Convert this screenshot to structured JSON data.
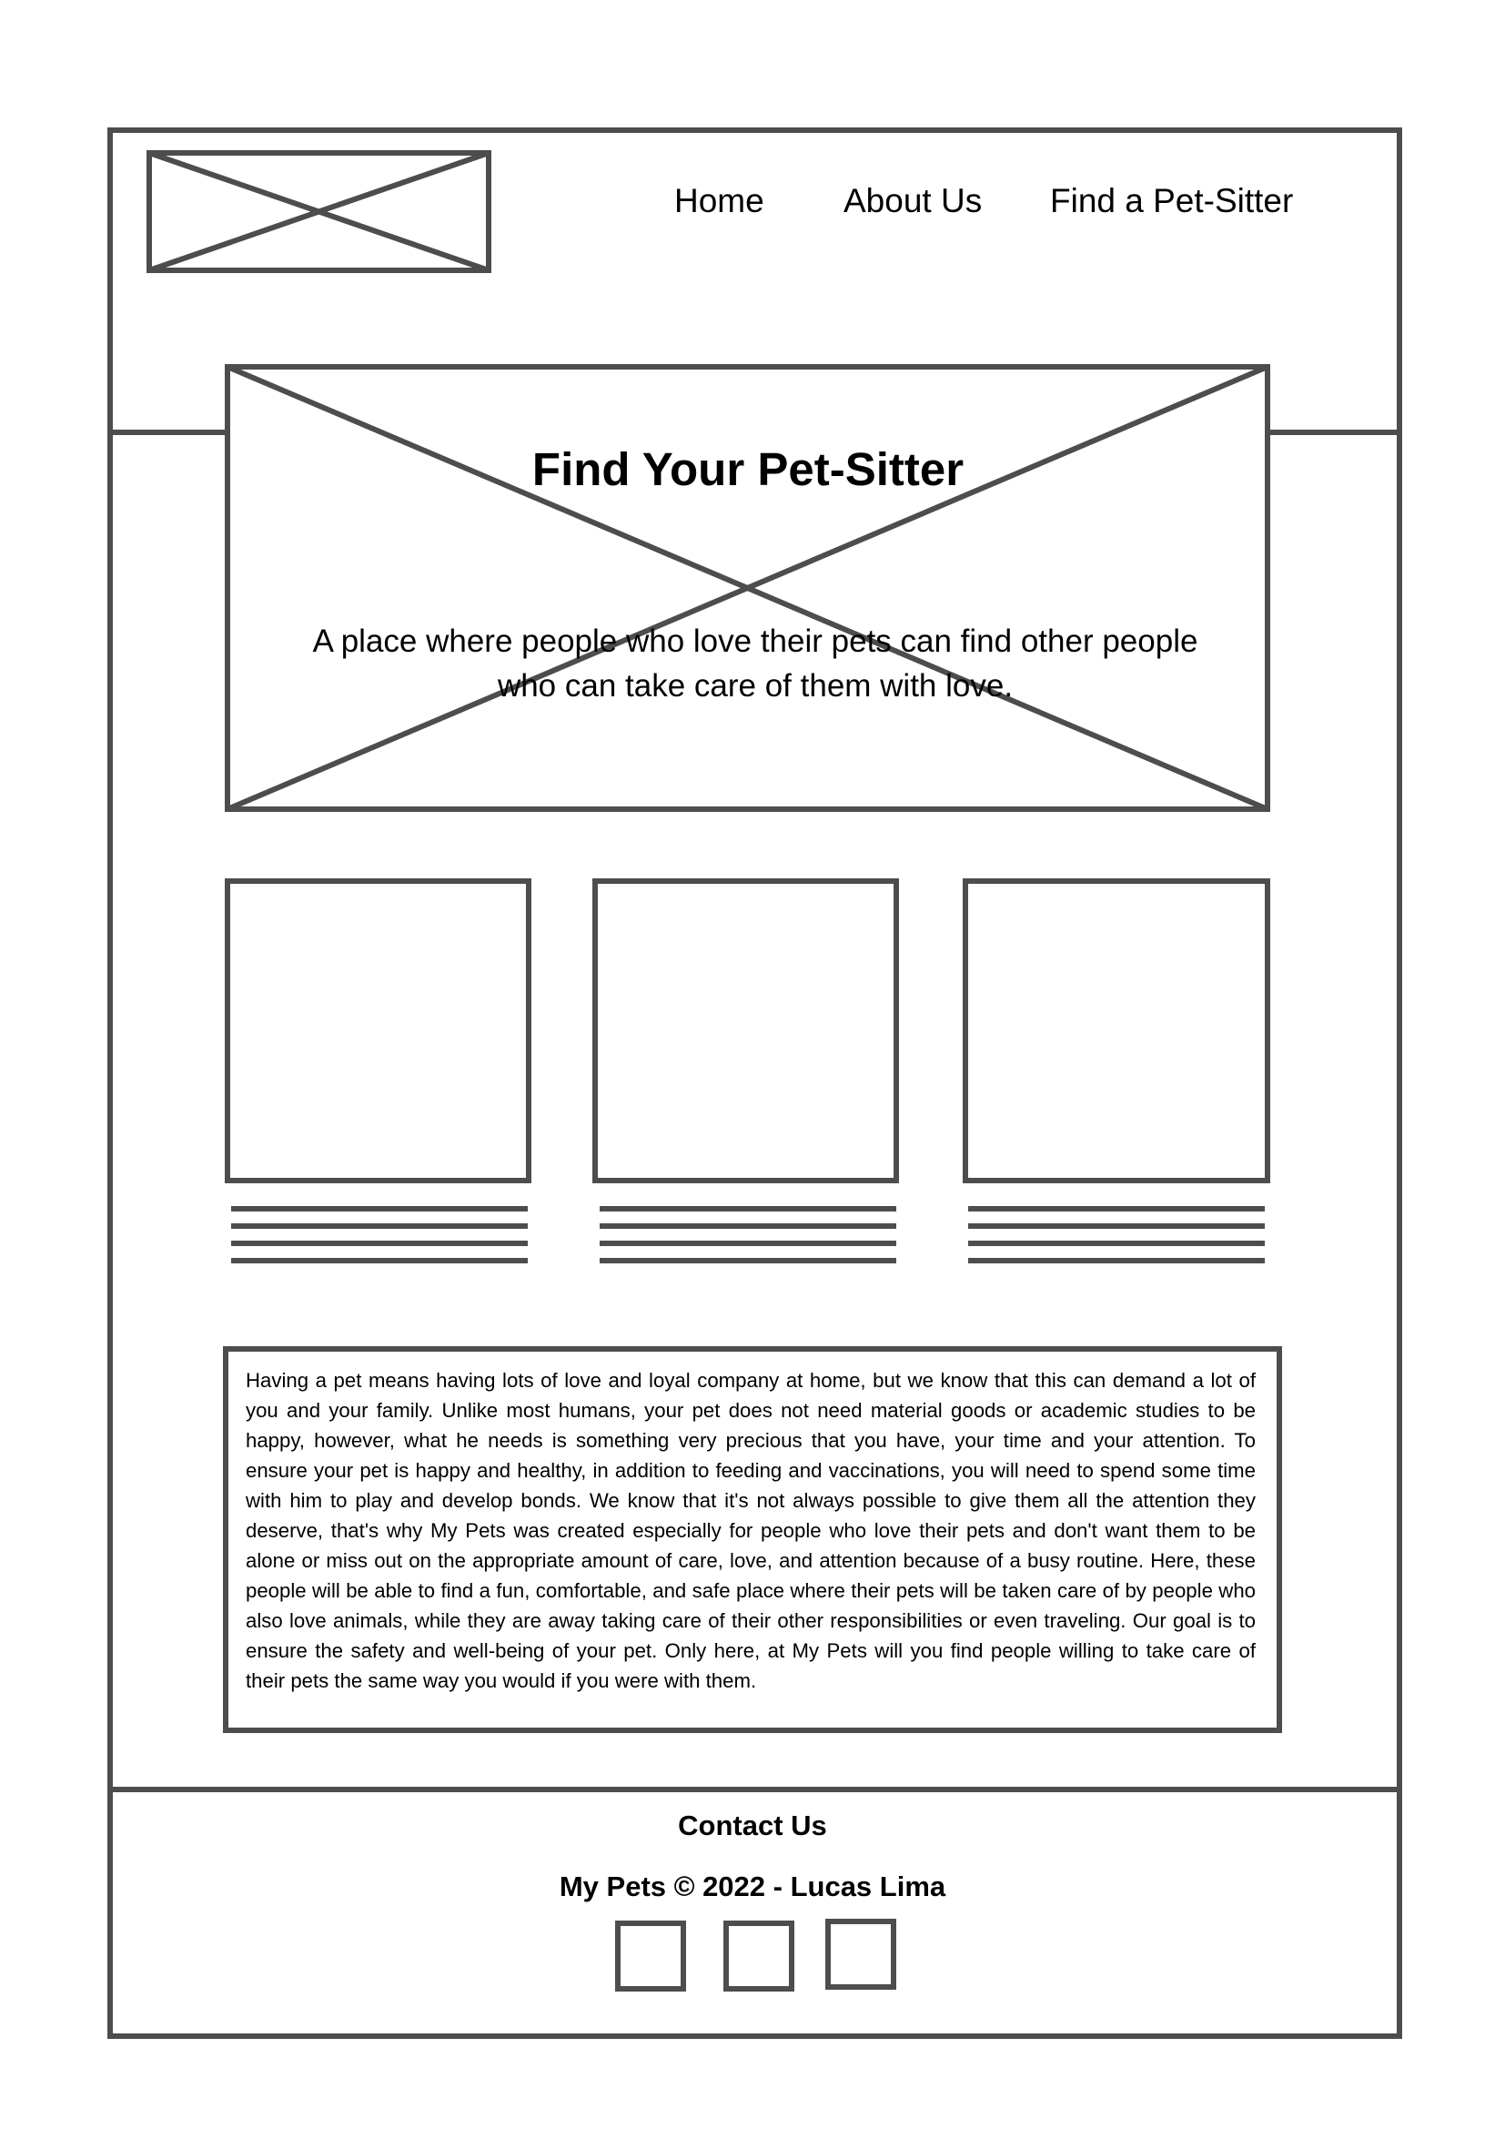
{
  "nav": {
    "items": [
      "Home",
      "About Us",
      "Find a Pet-Sitter"
    ]
  },
  "hero": {
    "title": "Find Your Pet-Sitter",
    "subtitle": "A place where people who love their pets can find other people who can take care of them with love."
  },
  "about": {
    "text": "Having a pet means having lots of love and loyal company at home, but we know that this can demand a lot of you and your family. Unlike most humans, your pet does not need material goods or academic studies to be happy, however, what he needs is something very precious that you have, your time and your attention. To ensure your pet is happy and healthy, in addition to feeding and vaccinations, you will need to spend some time with him to play and develop bonds. We know that it's not always possible to give them all the attention they deserve, that's why My Pets was created especially for people who love their pets and don't want them to be alone or miss out on the appropriate amount of care, love, and attention because of a busy routine. Here, these people will be able to find a fun, comfortable, and safe place where their pets will be taken care of by people who also love animals, while they are away taking care of their other responsibilities or even traveling. Our goal is to ensure the safety and well-being of your pet. Only here, at My Pets will you find people willing to take care of their pets the same way you would if you were with them."
  },
  "footer": {
    "contact_label": "Contact Us",
    "copyright": "My Pets © 2022 - Lucas Lima"
  },
  "colors": {
    "stroke": "#4d4d4d"
  }
}
